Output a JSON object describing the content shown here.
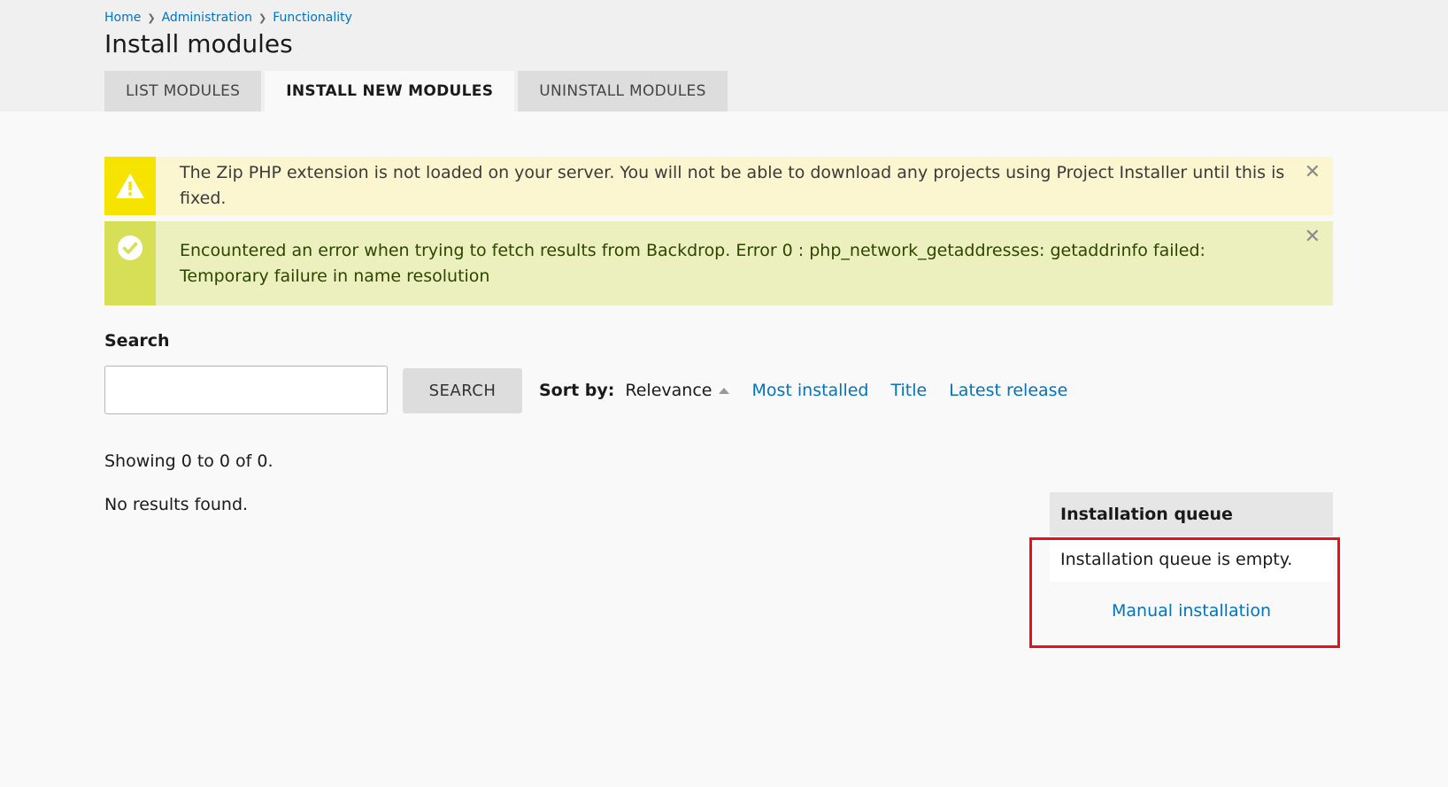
{
  "breadcrumb": {
    "items": [
      "Home",
      "Administration",
      "Functionality"
    ],
    "separator": ">"
  },
  "page": {
    "title": "Install modules"
  },
  "tabs": [
    {
      "label": "LIST MODULES",
      "active": false
    },
    {
      "label": "INSTALL NEW MODULES",
      "active": true
    },
    {
      "label": "UNINSTALL MODULES",
      "active": false
    }
  ],
  "messages": {
    "warning": {
      "text": "The Zip PHP extension is not loaded on your server. You will not be able to download any projects using Project Installer until this is fixed.",
      "icon": "warning-triangle-icon",
      "color": "#f7e300"
    },
    "status": {
      "text": "Encountered an error when trying to fetch results from Backdrop. Error 0 : php_network_getaddresses: getaddrinfo failed: Temporary failure in name resolution",
      "icon": "check-circle-icon",
      "color": "#d6df55"
    }
  },
  "search": {
    "label": "Search",
    "value": "",
    "button_label": "SEARCH"
  },
  "sort": {
    "label": "Sort by:",
    "current": "Relevance",
    "options": [
      "Most installed",
      "Title",
      "Latest release"
    ]
  },
  "results": {
    "showing": "Showing 0 to 0 of 0.",
    "empty": "No results found."
  },
  "queue": {
    "title": "Installation queue",
    "body": "Installation queue is empty.",
    "manual_link": "Manual installation"
  },
  "colors": {
    "link": "#0074bd",
    "highlight": "#e8101a"
  }
}
